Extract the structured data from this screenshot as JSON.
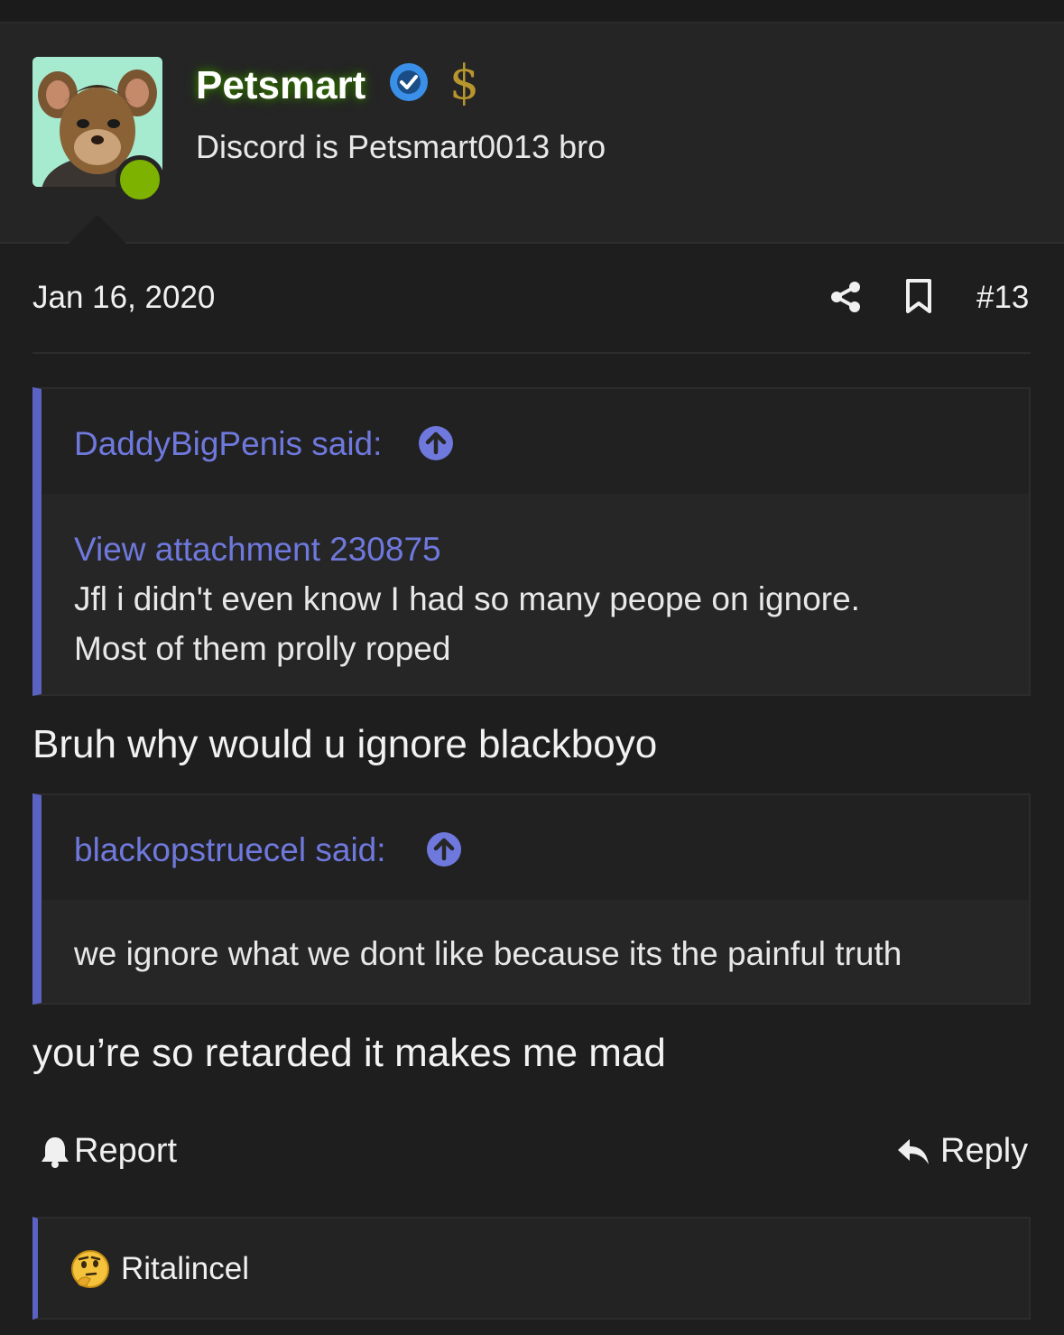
{
  "user": {
    "name": "Petsmart",
    "title": "Discord is Petsmart0013 bro",
    "badge_dollar": "$"
  },
  "post": {
    "date": "Jan 16, 2020",
    "number": "#13",
    "quotes": [
      {
        "author": "DaddyBigPenis said:",
        "attachment": "View attachment 230875",
        "lines": [
          "Jfl i didn't even know I had so many peope on ignore.",
          "Most of them prolly roped"
        ]
      },
      {
        "author": "blackopstruecel said:",
        "lines": [
          "we ignore what we dont like because its the painful truth"
        ]
      }
    ],
    "text1": "Bruh why would u ignore blackboyo",
    "text2": "you’re so retarded it makes me mad"
  },
  "actions": {
    "report": "Report",
    "reply": "Reply"
  },
  "reactions": {
    "user": "Ritalincel"
  },
  "colors": {
    "accent": "#5a62c2",
    "link": "#6f79dd",
    "online": "#7db300",
    "verified": "#3a8fe8"
  },
  "icons": [
    "share-icon",
    "bookmark-icon",
    "verified-icon",
    "arrow-up-circle-icon",
    "bell-icon",
    "reply-arrow-icon",
    "thinking-emoji-icon"
  ]
}
